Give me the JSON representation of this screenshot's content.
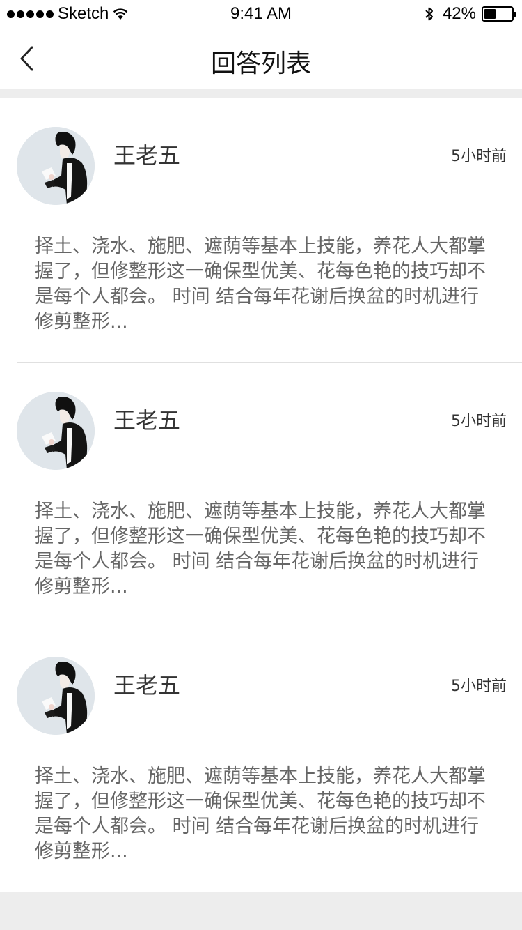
{
  "status_bar": {
    "carrier": "Sketch",
    "time": "9:41 AM",
    "battery_percent_text": "42%",
    "battery_level": 0.42,
    "icons": [
      "signal-dots-icon",
      "wifi-icon",
      "bluetooth-icon",
      "battery-icon"
    ]
  },
  "nav": {
    "title": "回答列表",
    "back_icon": "chevron-left-icon"
  },
  "answers": [
    {
      "author": "王老五",
      "time": "5小时前",
      "text": "择土、浇水、施肥、遮荫等基本上技能，养花人大都掌握了，但修整形这一确保型优美、花每色艳的技巧却不是每个人都会。 时间 结合每年花谢后换盆的时机进行修剪整形..."
    },
    {
      "author": "王老五",
      "time": "5小时前",
      "text": "择土、浇水、施肥、遮荫等基本上技能，养花人大都掌握了，但修整形这一确保型优美、花每色艳的技巧却不是每个人都会。 时间 结合每年花谢后换盆的时机进行修剪整形..."
    },
    {
      "author": "王老五",
      "time": "5小时前",
      "text": "择土、浇水、施肥、遮荫等基本上技能，养花人大都掌握了，但修整形这一确保型优美、花每色艳的技巧却不是每个人都会。 时间 结合每年花谢后换盆的时机进行修剪整形..."
    }
  ],
  "colors": {
    "page_background": "#ededed",
    "card_background": "#ffffff",
    "primary_text": "#333333",
    "secondary_text": "#666666",
    "divider": "#e0e0e0"
  }
}
